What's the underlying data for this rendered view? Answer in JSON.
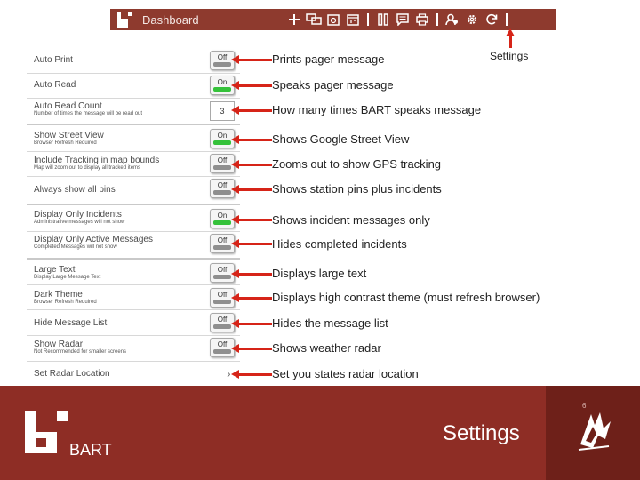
{
  "dashboard": {
    "title": "Dashboard",
    "icons": [
      "plus-icon",
      "chat-icon",
      "calendar-alert-icon",
      "calendar-icon",
      "pause-icon",
      "message-icon",
      "printer-icon",
      "users-icon",
      "gear-icon",
      "refresh-icon"
    ],
    "bar_color": "#8e3a2e"
  },
  "callout": {
    "settings_label": "Settings"
  },
  "settings": [
    {
      "label": "Auto Print",
      "sublabel": "",
      "control": "toggle",
      "value": "Off",
      "desc": "Prints pager message"
    },
    {
      "label": "Auto Read",
      "sublabel": "",
      "control": "toggle",
      "value": "On",
      "desc": "Speaks pager message"
    },
    {
      "label": "Auto Read Count",
      "sublabel": "Number of times the message will be read out",
      "control": "number",
      "value": "3",
      "desc": "How many times BART speaks message"
    },
    {
      "label": "Show Street View",
      "sublabel": "Browser Refresh Required",
      "control": "toggle",
      "value": "On",
      "desc": "Shows Google Street View"
    },
    {
      "label": "Include Tracking in map bounds",
      "sublabel": "Map will zoom out to display all tracked items",
      "control": "toggle",
      "value": "Off",
      "desc": "Zooms out to show GPS tracking"
    },
    {
      "label": "Always show all pins",
      "sublabel": "",
      "control": "toggle",
      "value": "Off",
      "desc": "Shows station pins plus incidents"
    },
    {
      "label": "Display Only Incidents",
      "sublabel": "Administrative messages will not show",
      "control": "toggle",
      "value": "On",
      "desc": "Shows incident messages only"
    },
    {
      "label": "Display Only Active Messages",
      "sublabel": "Completed Messages will not show",
      "control": "toggle",
      "value": "Off",
      "desc": "Hides completed incidents"
    },
    {
      "label": "Large Text",
      "sublabel": "Display Large Message Text",
      "control": "toggle",
      "value": "Off",
      "desc": "Displays large text"
    },
    {
      "label": "Dark Theme",
      "sublabel": "Browser Refresh Required",
      "control": "toggle",
      "value": "Off",
      "desc": "Displays high contrast theme (must refresh browser)"
    },
    {
      "label": "Hide Message List",
      "sublabel": "",
      "control": "toggle",
      "value": "Off",
      "desc": "Hides the message list"
    },
    {
      "label": "Show Radar",
      "sublabel": "Not Recommended for smaller screens",
      "control": "toggle",
      "value": "Off",
      "desc": "Shows weather radar"
    },
    {
      "label": "Set Radar Location",
      "sublabel": "",
      "control": "chevron",
      "value": "",
      "desc": "Set you states radar location"
    }
  ],
  "footer": {
    "page_number": "6",
    "title": "Settings",
    "brand": "BART",
    "bg_color": "#8e2d25",
    "accent_color": "#d62418"
  }
}
